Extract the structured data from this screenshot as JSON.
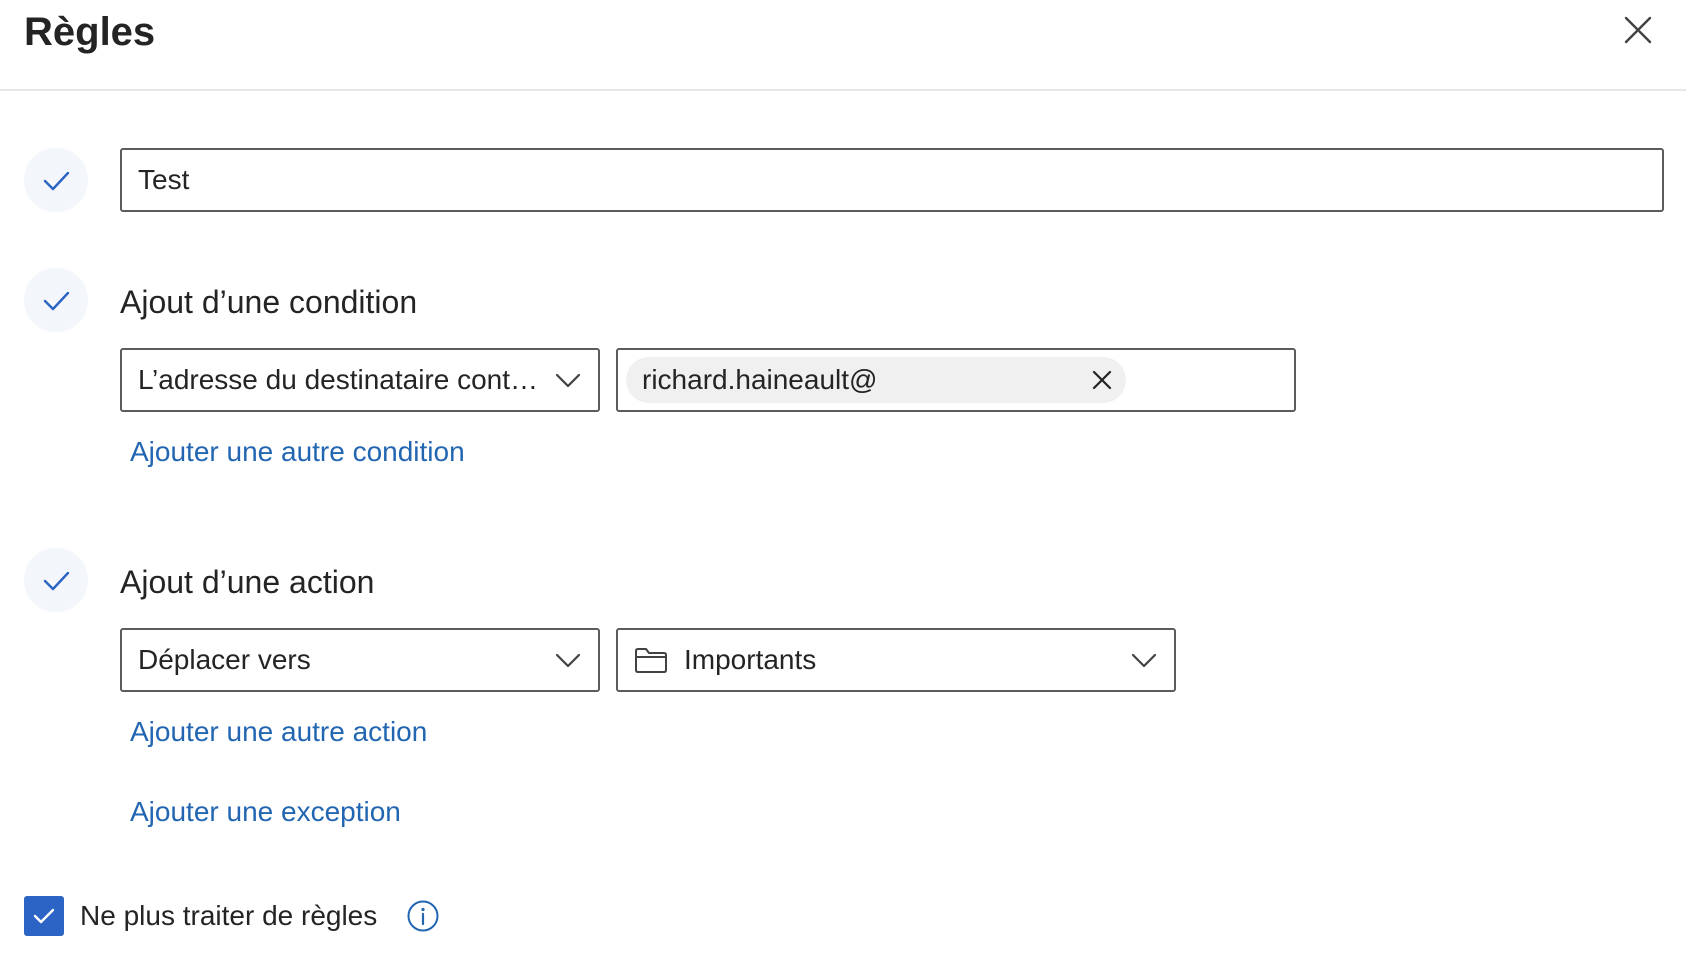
{
  "header": {
    "title": "Règles"
  },
  "rule_name": {
    "value": "Test"
  },
  "condition": {
    "heading": "Ajout d’une condition",
    "selected": "L’adresse du destinataire contient",
    "recipient_chip": "richard.haineault@",
    "add_link": "Ajouter une autre condition"
  },
  "action": {
    "heading": "Ajout d’une action",
    "selected": "Déplacer vers",
    "folder": "Importants",
    "add_link": "Ajouter une autre action"
  },
  "exception": {
    "add_link": "Ajouter une exception"
  },
  "stop_processing": {
    "label": "Ne plus traiter de règles",
    "checked": true
  },
  "icons": {
    "close": "close-icon",
    "step": "checkmark-icon",
    "chevron": "chevron-down-icon",
    "folder": "folder-icon",
    "info": "info-icon"
  },
  "colors": {
    "accent": "#2b64c4",
    "link": "#2266b2",
    "step_circle": "#f3f6fb",
    "step_check": "#2b64c4"
  }
}
